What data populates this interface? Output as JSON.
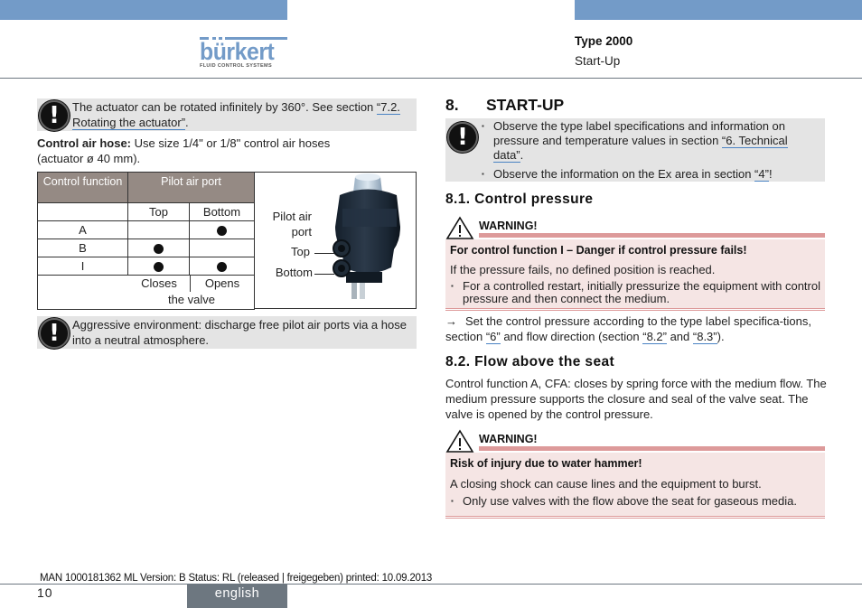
{
  "header": {
    "logo_word": "bürkert",
    "logo_tagline": "FLUID CONTROL SYSTEMS",
    "type_label": "Type 2000",
    "section_label": "Start-Up",
    "band_color": "#739bc8"
  },
  "left": {
    "note1": {
      "icon": "exclamation-circle-icon",
      "text_before": "The actuator can be rotated infinitely by 360°. See section ",
      "link": "“7.2. Rotating the actuator”",
      "text_after": "."
    },
    "hose": {
      "label": "Control air hose:",
      "text": " Use size 1/4\" or 1/8\" control air hoses",
      "text2": "(actuator ø 40 mm)."
    },
    "table": {
      "header_col1": "Control function",
      "header_col2": "Pilot air port",
      "sub_top": "Top",
      "sub_bottom": "Bottom",
      "rows": [
        {
          "fn": "A",
          "top": false,
          "bottom": true
        },
        {
          "fn": "B",
          "top": true,
          "bottom": false
        },
        {
          "fn": "I",
          "top": true,
          "bottom": true
        }
      ],
      "closes": "Closes",
      "opens": "Opens",
      "the_valve": "the valve"
    },
    "figure": {
      "label_port": "Pilot air port",
      "label_port_1": "Pilot air",
      "label_port_2": "port",
      "label_top": "Top",
      "label_bottom": "Bottom"
    },
    "note2": {
      "icon": "exclamation-circle-icon",
      "text": "Aggressive environment: discharge free pilot air ports via a hose into a neutral atmosphere."
    }
  },
  "right": {
    "section_num": "8.",
    "section_title": "START-UP",
    "note": {
      "bullet1_before": "Observe the type label specifications and information on pressure and temperature values in section ",
      "bullet1_link": "“6. Technical data”",
      "bullet1_after": ".",
      "bullet2_before": "Observe the information on the Ex area in section ",
      "bullet2_link": "“4”",
      "bullet2_after": "!"
    },
    "sub1": {
      "title": "8.1. Control pressure",
      "warning_label": "WARNING!",
      "warning_heading": "For control function I – Danger if control pressure fails!",
      "warning_text": "If the pressure fails, no defined position is reached.",
      "warning_bullet": "For a controlled restart, initially pressurize the equipment with control pressure and then connect the medium.",
      "step_arrow": "→",
      "step_before": "Set the control pressure according to the type label specifica-tions, section ",
      "step_link1": "“6”",
      "step_mid": " and flow direction (section ",
      "step_link2": "“8.2”",
      "step_and": " and ",
      "step_link3": "“8.3”",
      "step_after": ")."
    },
    "sub2": {
      "title": "8.2. Flow above the seat",
      "para": "Control function A, CFA: closes by spring force with the medium flow. The medium pressure supports the closure and seal of the valve seat. The valve is opened by the control pressure.",
      "warning_label": "WARNING!",
      "warning_heading": "Risk of injury due to water hammer!",
      "warning_text": "A closing shock can cause lines and the equipment to burst.",
      "warning_bullet": "Only use valves with the flow above the seat for gaseous media."
    }
  },
  "footer": {
    "meta": "MAN  1000181362  ML  Version: B Status: RL (released | freigegeben)  printed: 10.09.2013",
    "page_number": "10",
    "language": "english"
  }
}
